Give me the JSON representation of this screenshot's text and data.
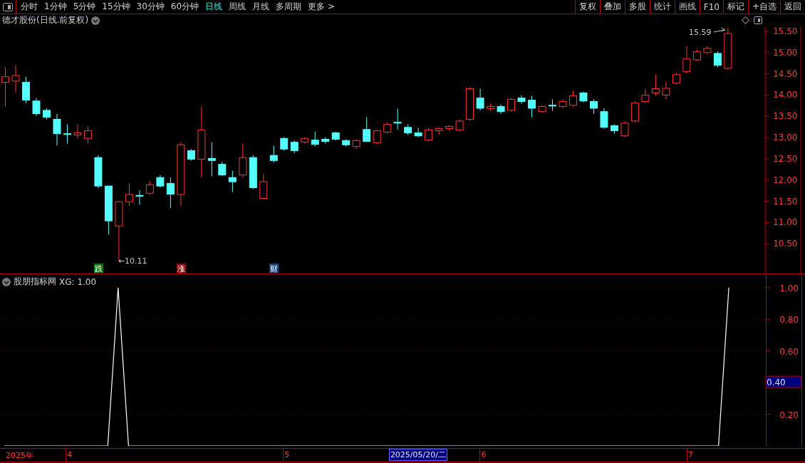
{
  "toolbar": {
    "periods": [
      {
        "label": "分时",
        "selected": false
      },
      {
        "label": "1分钟",
        "selected": false
      },
      {
        "label": "5分钟",
        "selected": false
      },
      {
        "label": "15分钟",
        "selected": false
      },
      {
        "label": "30分钟",
        "selected": false
      },
      {
        "label": "60分钟",
        "selected": false
      },
      {
        "label": "日线",
        "selected": true
      },
      {
        "label": "周线",
        "selected": false
      },
      {
        "label": "月线",
        "selected": false
      },
      {
        "label": "多周期",
        "selected": false
      },
      {
        "label": "更多 >",
        "selected": false
      }
    ],
    "buttons": [
      "复权",
      "叠加",
      "多股",
      "统计",
      "画线",
      "F10",
      "标记",
      "+自选",
      "返回"
    ]
  },
  "main_chart": {
    "title": "德才股份(日线.前复权)",
    "high_label": "15.59",
    "low_label": "←10.11",
    "markers": [
      {
        "text": "跌",
        "color": "#0a7a0a"
      },
      {
        "text": "涨",
        "color": "#8a0a0a"
      },
      {
        "text": "财",
        "color": "#1c4a84"
      }
    ],
    "chart_data": {
      "type": "candlestick",
      "ylim": [
        9.8,
        15.6
      ],
      "yticks": [
        {
          "value": 15.5,
          "label": "15.50"
        },
        {
          "value": 15,
          "label": "15.00"
        },
        {
          "value": 14.5,
          "label": "14.50"
        },
        {
          "value": 14,
          "label": "14.00"
        },
        {
          "value": 13.5,
          "label": "13.50"
        },
        {
          "value": 13,
          "label": "13.00"
        },
        {
          "value": 12.5,
          "label": "12.50"
        },
        {
          "value": 12,
          "label": "12.00"
        },
        {
          "value": 11.5,
          "label": "11.50"
        },
        {
          "value": 11,
          "label": "11.00"
        },
        {
          "value": 10.5,
          "label": "10.50"
        }
      ],
      "ohlc": [
        [
          14.3,
          14.65,
          13.73,
          14.43
        ],
        [
          14.33,
          14.7,
          14.06,
          14.46
        ],
        [
          14.3,
          14.43,
          13.81,
          13.88
        ],
        [
          13.86,
          13.93,
          13.51,
          13.56
        ],
        [
          13.64,
          13.69,
          13.43,
          13.48
        ],
        [
          13.43,
          13.56,
          12.81,
          13.09
        ],
        [
          13.09,
          13.31,
          12.86,
          13.08
        ],
        [
          13.06,
          13.31,
          12.98,
          13.11
        ],
        [
          12.98,
          13.26,
          12.86,
          13.16
        ],
        [
          12.53,
          12.59,
          11.81,
          11.86
        ],
        [
          11.86,
          11.86,
          10.72,
          11.04
        ],
        [
          10.92,
          11.51,
          10.11,
          11.49
        ],
        [
          11.49,
          11.92,
          11.39,
          11.66
        ],
        [
          11.64,
          11.76,
          11.42,
          11.62
        ],
        [
          11.69,
          11.97,
          11.66,
          11.89
        ],
        [
          12.06,
          12.12,
          11.82,
          11.86
        ],
        [
          11.92,
          12.06,
          11.34,
          11.67
        ],
        [
          11.66,
          12.89,
          11.39,
          12.83
        ],
        [
          12.69,
          12.73,
          12.46,
          12.49
        ],
        [
          12.49,
          13.73,
          12.06,
          13.18
        ],
        [
          12.51,
          12.89,
          12.09,
          12.46
        ],
        [
          12.37,
          12.43,
          12.09,
          12.12
        ],
        [
          12.06,
          12.22,
          11.72,
          11.96
        ],
        [
          12.12,
          12.86,
          12.06,
          12.53
        ],
        [
          12.53,
          12.59,
          11.79,
          11.82
        ],
        [
          11.57,
          12.14,
          11.57,
          11.96
        ],
        [
          12.58,
          12.81,
          12.41,
          12.46
        ],
        [
          12.98,
          13.01,
          12.69,
          12.73
        ],
        [
          12.89,
          12.93,
          12.63,
          12.69
        ],
        [
          12.89,
          13.01,
          12.86,
          12.98
        ],
        [
          12.94,
          13.14,
          12.79,
          12.84
        ],
        [
          12.96,
          13.01,
          12.86,
          12.91
        ],
        [
          13.11,
          13.14,
          12.93,
          12.96
        ],
        [
          12.93,
          12.96,
          12.79,
          12.83
        ],
        [
          12.79,
          12.96,
          12.73,
          12.93
        ],
        [
          13.19,
          13.48,
          12.89,
          12.91
        ],
        [
          12.88,
          13.19,
          12.84,
          13.16
        ],
        [
          13.13,
          13.36,
          13.09,
          13.31
        ],
        [
          13.36,
          13.68,
          13.19,
          13.34
        ],
        [
          13.24,
          13.31,
          13.06,
          13.11
        ],
        [
          13.11,
          13.23,
          13.01,
          13.04
        ],
        [
          12.94,
          13.23,
          12.91,
          13.18
        ],
        [
          13.16,
          13.24,
          13.06,
          13.21
        ],
        [
          13.21,
          13.29,
          13.16,
          13.26
        ],
        [
          13.18,
          13.43,
          13.14,
          13.39
        ],
        [
          13.43,
          14.18,
          13.39,
          14.15
        ],
        [
          13.93,
          14.15,
          13.64,
          13.69
        ],
        [
          13.68,
          13.81,
          13.63,
          13.73
        ],
        [
          13.73,
          13.78,
          13.56,
          13.61
        ],
        [
          13.64,
          13.93,
          13.61,
          13.9
        ],
        [
          13.93,
          14.0,
          13.8,
          13.85
        ],
        [
          13.88,
          13.98,
          13.48,
          13.69
        ],
        [
          13.61,
          13.76,
          13.58,
          13.73
        ],
        [
          13.76,
          13.9,
          13.63,
          13.75
        ],
        [
          13.73,
          13.9,
          13.69,
          13.85
        ],
        [
          13.76,
          14.1,
          13.73,
          13.98
        ],
        [
          14.05,
          14.08,
          13.83,
          13.86
        ],
        [
          13.85,
          13.9,
          13.56,
          13.69
        ],
        [
          13.61,
          13.69,
          13.21,
          13.24
        ],
        [
          13.28,
          13.31,
          13.09,
          13.16
        ],
        [
          13.04,
          13.38,
          13.01,
          13.34
        ],
        [
          13.39,
          13.85,
          13.36,
          13.81
        ],
        [
          13.85,
          14.15,
          13.81,
          14.0
        ],
        [
          14.05,
          14.48,
          13.98,
          14.15
        ],
        [
          14.0,
          14.31,
          13.9,
          14.16
        ],
        [
          14.28,
          14.53,
          14.25,
          14.48
        ],
        [
          14.55,
          15.15,
          14.51,
          14.85
        ],
        [
          14.83,
          15.07,
          14.8,
          15.02
        ],
        [
          15.0,
          15.15,
          14.97,
          15.1
        ],
        [
          14.98,
          15.03,
          14.65,
          14.7
        ],
        [
          14.63,
          15.59,
          14.6,
          15.45
        ]
      ]
    }
  },
  "indicator": {
    "title": "股朋指标网",
    "reading": "XG: 1.00",
    "crosshair_label": "0.40",
    "chart_data": {
      "type": "line",
      "ylim": [
        0,
        1.08
      ],
      "grid": true,
      "yticks": [
        {
          "value": 0.2,
          "label": "0.20"
        },
        {
          "value": 0.6,
          "label": "0.60"
        },
        {
          "value": 0.8,
          "label": "0.80"
        },
        {
          "value": 1,
          "label": "1.00"
        }
      ],
      "series": [
        {
          "color": "#ffffff",
          "values": [
            0,
            0,
            0,
            0,
            0,
            0,
            0,
            0,
            0,
            0,
            0,
            1,
            0,
            0,
            0,
            0,
            0,
            0,
            0,
            0,
            0,
            0,
            0,
            0,
            0,
            0,
            0,
            0,
            0,
            0,
            0,
            0,
            0,
            0,
            0,
            0,
            0,
            0,
            0,
            0,
            0,
            0,
            0,
            0,
            0,
            0,
            0,
            0,
            0,
            0,
            0,
            0,
            0,
            0,
            0,
            0,
            0,
            0,
            0,
            0,
            0,
            0,
            0,
            0,
            0,
            0,
            0,
            0,
            0,
            0,
            1
          ]
        }
      ]
    }
  },
  "time_axis": {
    "year": "2025年",
    "months": [
      "4",
      "5",
      "6",
      "7"
    ],
    "cursor_date": "2025/05/20/二"
  }
}
